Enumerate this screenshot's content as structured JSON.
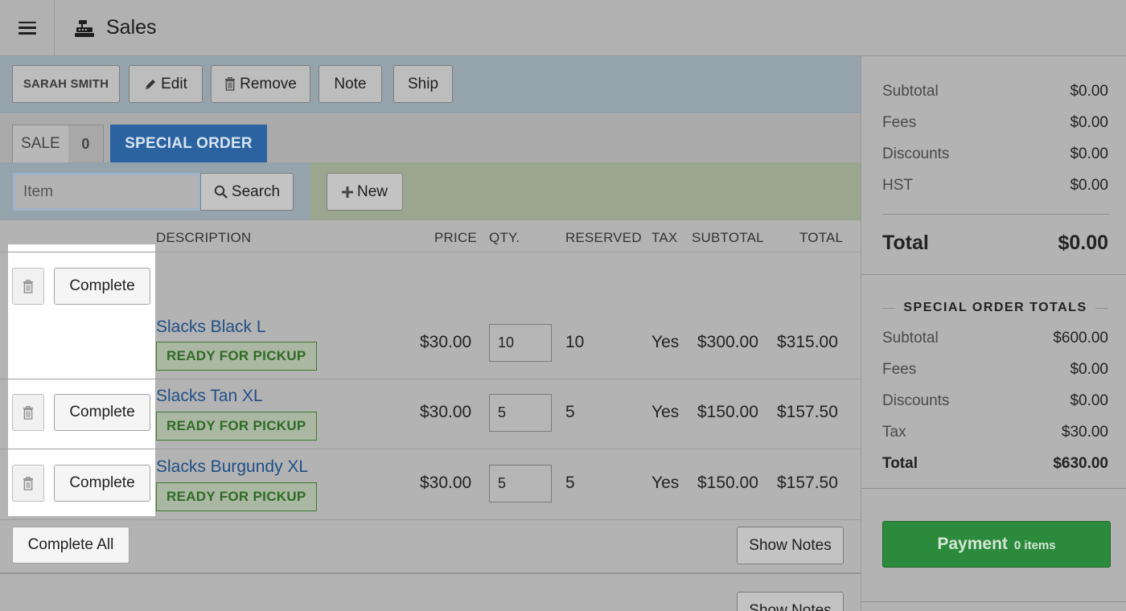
{
  "header": {
    "title": "Sales",
    "icon": "register-icon",
    "menu_icon": "hamburger-menu-icon"
  },
  "toolbar": {
    "customer_label": "SARAH SMITH",
    "edit_label": "Edit",
    "remove_label": "Remove",
    "note_label": "Note",
    "ship_label": "Ship"
  },
  "tabs": {
    "sale_label": "SALE",
    "sale_count": "0",
    "special_order_label": "SPECIAL ORDER"
  },
  "search": {
    "placeholder": "Item",
    "search_label": "Search",
    "new_label": "New"
  },
  "table": {
    "headers": {
      "description": "DESCRIPTION",
      "price": "PRICE",
      "qty": "QTY.",
      "reserved": "RESERVED",
      "tax": "TAX",
      "subtotal": "SUBTOTAL",
      "total": "TOTAL"
    },
    "complete_label": "Complete",
    "rows": [
      {
        "description": "Slacks Black L",
        "status": "READY FOR PICKUP",
        "price": "$30.00",
        "qty": "10",
        "reserved": "10",
        "tax": "Yes",
        "subtotal": "$300.00",
        "total": "$315.00"
      },
      {
        "description": "Slacks Tan XL",
        "status": "READY FOR PICKUP",
        "price": "$30.00",
        "qty": "5",
        "reserved": "5",
        "tax": "Yes",
        "subtotal": "$150.00",
        "total": "$157.50"
      },
      {
        "description": "Slacks Burgundy XL",
        "status": "READY FOR PICKUP",
        "price": "$30.00",
        "qty": "5",
        "reserved": "5",
        "tax": "Yes",
        "subtotal": "$150.00",
        "total": "$157.50"
      }
    ],
    "complete_all_label": "Complete All",
    "show_notes_label": "Show Notes",
    "show_notes_label_2": "Show Notes"
  },
  "summary": {
    "rows": [
      {
        "label": "Subtotal",
        "value": "$0.00"
      },
      {
        "label": "Fees",
        "value": "$0.00"
      },
      {
        "label": "Discounts",
        "value": "$0.00"
      },
      {
        "label": "HST",
        "value": "$0.00"
      }
    ],
    "total_label": "Total",
    "total_value": "$0.00"
  },
  "special_order_totals": {
    "title": "SPECIAL ORDER TOTALS",
    "rows": [
      {
        "label": "Subtotal",
        "value": "$600.00"
      },
      {
        "label": "Fees",
        "value": "$0.00"
      },
      {
        "label": "Discounts",
        "value": "$0.00"
      },
      {
        "label": "Tax",
        "value": "$30.00"
      }
    ],
    "total_label": "Total",
    "total_value": "$630.00"
  },
  "payment": {
    "label": "Payment",
    "items": "0 items"
  },
  "colors": {
    "special_order_tab": "#2a63a0",
    "link": "#1f4f86",
    "status_green": "#2f6b24",
    "payment_button": "#2c8a3c"
  }
}
